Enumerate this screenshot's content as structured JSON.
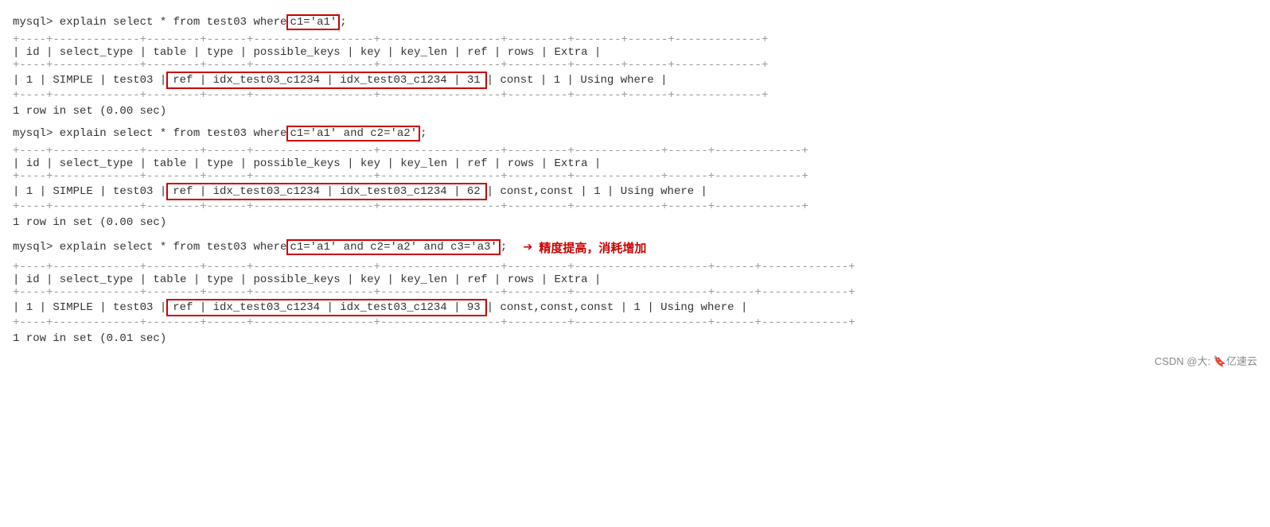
{
  "blocks": [
    {
      "id": "block1",
      "query_prefix": "mysql> explain select * from test03 where ",
      "query_highlight": "c1='a1'",
      "query_suffix": ";",
      "columns": [
        "id",
        "select_type",
        "table",
        "type",
        "possible_keys",
        "key",
        "key_len",
        "ref",
        "rows",
        "Extra"
      ],
      "row": {
        "id": "1",
        "select_type": "SIMPLE",
        "table": "test03",
        "type": "ref",
        "possible_keys": "idx_test03_c1234",
        "key": "idx_test03_c1234",
        "key_len": "31",
        "ref": "const",
        "rows": "1",
        "extra": "Using where"
      },
      "rowset": "1 row in set (0.00 sec)",
      "has_annotation": false
    },
    {
      "id": "block2",
      "query_prefix": "mysql> explain select * from test03 where ",
      "query_highlight": "c1='a1' and c2='a2'",
      "query_suffix": ";",
      "columns": [
        "id",
        "select_type",
        "table",
        "type",
        "possible_keys",
        "key",
        "key_len",
        "ref",
        "rows",
        "Extra"
      ],
      "row": {
        "id": "1",
        "select_type": "SIMPLE",
        "table": "test03",
        "type": "ref",
        "possible_keys": "idx_test03_c1234",
        "key": "idx_test03_c1234",
        "key_len": "62",
        "ref": "const,const",
        "rows": "1",
        "extra": "Using where"
      },
      "rowset": "1 row in set (0.00 sec)",
      "has_annotation": false
    },
    {
      "id": "block3",
      "query_prefix": "mysql> explain select * from test03 where ",
      "query_highlight": "c1='a1' and c2='a2' and c3='a3'",
      "query_suffix": ";",
      "annotation": "精度提高，消耗增加",
      "columns": [
        "id",
        "select_type",
        "table",
        "type",
        "possible_keys",
        "key",
        "key_len",
        "ref",
        "rows",
        "Extra"
      ],
      "row": {
        "id": "1",
        "select_type": "SIMPLE",
        "table": "test03",
        "type": "ref",
        "possible_keys": "idx_test03_c1234",
        "key": "idx_test03_c1234",
        "key_len": "93",
        "ref": "const,const,const",
        "rows": "1",
        "extra": "Using where"
      },
      "rowset": "1 row in set (0.01 sec)",
      "has_annotation": true
    }
  ],
  "footer": "CSDN @大: 🔖亿速云",
  "divider_top": "+----+-------------+--------+------+-----------------+-----------------+---------+",
  "divider_mid": "+----+-------------+--------+------+-----------------+-----------------+---------+"
}
